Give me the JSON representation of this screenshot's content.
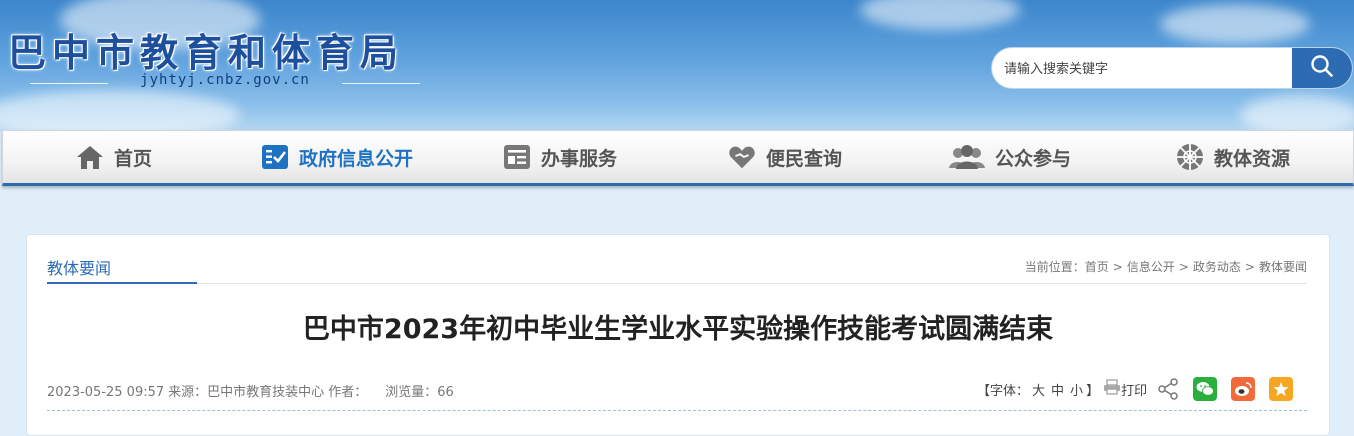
{
  "header": {
    "site_title": "巴中市教育和体育局",
    "domain": "jyhtyj.cnbz.gov.cn"
  },
  "search": {
    "placeholder": "请输入搜索关键字",
    "button_icon": "search-icon"
  },
  "nav": {
    "items": [
      {
        "label": "首页",
        "icon": "home-icon"
      },
      {
        "label": "政府信息公开",
        "icon": "checklist-icon",
        "active": true
      },
      {
        "label": "办事服务",
        "icon": "card-icon"
      },
      {
        "label": "便民查询",
        "icon": "heart-icon"
      },
      {
        "label": "公众参与",
        "icon": "users-icon"
      },
      {
        "label": "教体资源",
        "icon": "ball-icon"
      }
    ]
  },
  "section": {
    "label": "教体要闻"
  },
  "breadcrumb": {
    "prefix": "当前位置：",
    "items": [
      "首页",
      "信息公开",
      "政务动态",
      "教体要闻"
    ],
    "separator": ">"
  },
  "article": {
    "title": "巴中市2023年初中毕业生学业水平实验操作技能考试圆满结束",
    "date": "2023-05-25 09:57",
    "source_label": "来源：",
    "source": "巴中市教育技装中心",
    "author_label": "作者：",
    "author": "",
    "views_label": "浏览量：",
    "views": "66"
  },
  "tools": {
    "font_label_open": "【字体：",
    "font_large": "大",
    "font_medium": "中",
    "font_small": "小",
    "font_label_close": "】",
    "print_label": "打印",
    "share_icons": [
      "share-icon",
      "wechat-icon",
      "weibo-icon",
      "favorite-icon"
    ]
  },
  "colors": {
    "brand_blue": "#2d6bb3",
    "active_nav": "#1f72c2",
    "wechat": "#2aae3c",
    "weibo": "#f06a3a",
    "favorite": "#f5a623"
  }
}
